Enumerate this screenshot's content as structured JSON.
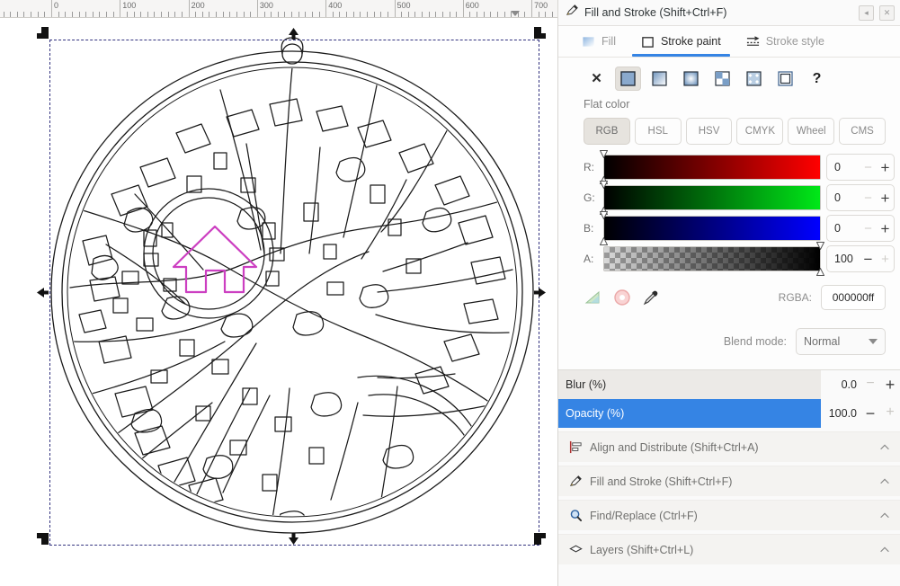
{
  "window": {
    "panel_title": "Fill and Stroke (Shift+Ctrl+F)",
    "panel_icon": "fill-and-stroke-icon",
    "dock_left_button": "dock-left-icon",
    "close_button": "close-icon"
  },
  "ruler": {
    "unit_labels": [
      "0",
      "100",
      "200",
      "300",
      "400",
      "500",
      "600",
      "700"
    ]
  },
  "canvas": {
    "description": "map-medallion-line-drawing",
    "marker": "house-outline-marker",
    "marker_color": "#cc3fc1",
    "stroke_color": "#1a1a1a",
    "selection": "object-selected-scale-handles"
  },
  "tabs": [
    {
      "label": "Fill",
      "icon": "fill-swatch-icon",
      "active": false
    },
    {
      "label": "Stroke paint",
      "icon": "stroke-square-icon",
      "active": true
    },
    {
      "label": "Stroke style",
      "icon": "stroke-style-icon",
      "active": false
    }
  ],
  "paint_types": [
    {
      "name": "no-paint",
      "icon": "x-icon",
      "selected": false
    },
    {
      "name": "flat-color",
      "icon": "flat-color-icon",
      "selected": true
    },
    {
      "name": "linear-gradient",
      "icon": "linear-gradient-icon",
      "selected": false
    },
    {
      "name": "radial-gradient",
      "icon": "radial-gradient-icon",
      "selected": false
    },
    {
      "name": "pattern",
      "icon": "pattern-icon",
      "selected": false
    },
    {
      "name": "swatch",
      "icon": "swatch-icon",
      "selected": false
    },
    {
      "name": "unknown-paint",
      "icon": "unknown-paint-icon",
      "selected": false
    },
    {
      "name": "help",
      "icon": "question-mark-icon",
      "selected": false
    }
  ],
  "paint_type_label": "Flat color",
  "color_modes": [
    {
      "label": "RGB",
      "selected": true
    },
    {
      "label": "HSL",
      "selected": false
    },
    {
      "label": "HSV",
      "selected": false
    },
    {
      "label": "CMYK",
      "selected": false
    },
    {
      "label": "Wheel",
      "selected": false
    },
    {
      "label": "CMS",
      "selected": false
    }
  ],
  "channels": [
    {
      "label": "R:",
      "value": "0",
      "minus_enabled": false,
      "plus_enabled": true,
      "knob": "left"
    },
    {
      "label": "G:",
      "value": "0",
      "minus_enabled": false,
      "plus_enabled": true,
      "knob": "left"
    },
    {
      "label": "B:",
      "value": "0",
      "minus_enabled": false,
      "plus_enabled": true,
      "knob": "left"
    },
    {
      "label": "A:",
      "value": "100",
      "minus_enabled": true,
      "plus_enabled": false,
      "knob": "right"
    }
  ],
  "color_tools": [
    {
      "name": "color-gamut-icon"
    },
    {
      "name": "color-managed-icon"
    },
    {
      "name": "eyedropper-icon"
    }
  ],
  "rgba": {
    "label": "RGBA:",
    "value": "000000ff"
  },
  "blend": {
    "label": "Blend mode:",
    "value": "Normal"
  },
  "scales": [
    {
      "label": "Blur (%)",
      "value": "0.0",
      "percent": 0,
      "minus_enabled": false,
      "plus_enabled": true
    },
    {
      "label": "Opacity (%)",
      "value": "100.0",
      "percent": 100,
      "minus_enabled": true,
      "plus_enabled": false
    }
  ],
  "dock_sections": [
    {
      "label": "Align and Distribute (Shift+Ctrl+A)",
      "icon": "align-distribute-icon"
    },
    {
      "label": "Fill and Stroke (Shift+Ctrl+F)",
      "icon": "fill-and-stroke-icon"
    },
    {
      "label": "Find/Replace (Ctrl+F)",
      "icon": "find-replace-icon"
    },
    {
      "label": "Layers (Shift+Ctrl+L)",
      "icon": "layers-icon"
    }
  ]
}
